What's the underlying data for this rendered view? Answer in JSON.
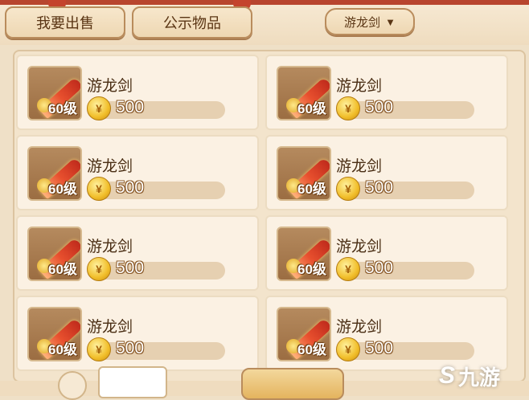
{
  "header": {
    "sell_label": "我要出售",
    "public_label": "公示物品",
    "filter_label": "游龙剑",
    "filter_arrow": "▼"
  },
  "items": [
    {
      "name": "游龙剑",
      "level": "60级",
      "price": "500",
      "icon": "sword-icon"
    },
    {
      "name": "游龙剑",
      "level": "60级",
      "price": "500",
      "icon": "sword-icon"
    },
    {
      "name": "游龙剑",
      "level": "60级",
      "price": "500",
      "icon": "sword-icon"
    },
    {
      "name": "游龙剑",
      "level": "60级",
      "price": "500",
      "icon": "sword-icon"
    },
    {
      "name": "游龙剑",
      "level": "60级",
      "price": "500",
      "icon": "sword-icon"
    },
    {
      "name": "游龙剑",
      "level": "60级",
      "price": "500",
      "icon": "sword-icon"
    },
    {
      "name": "游龙剑",
      "level": "60级",
      "price": "500",
      "icon": "sword-icon"
    },
    {
      "name": "游龙剑",
      "level": "60级",
      "price": "500",
      "icon": "sword-icon"
    }
  ],
  "currency_icon": "gold-coin-icon",
  "watermark": {
    "symbol": "S",
    "text": "九游"
  }
}
